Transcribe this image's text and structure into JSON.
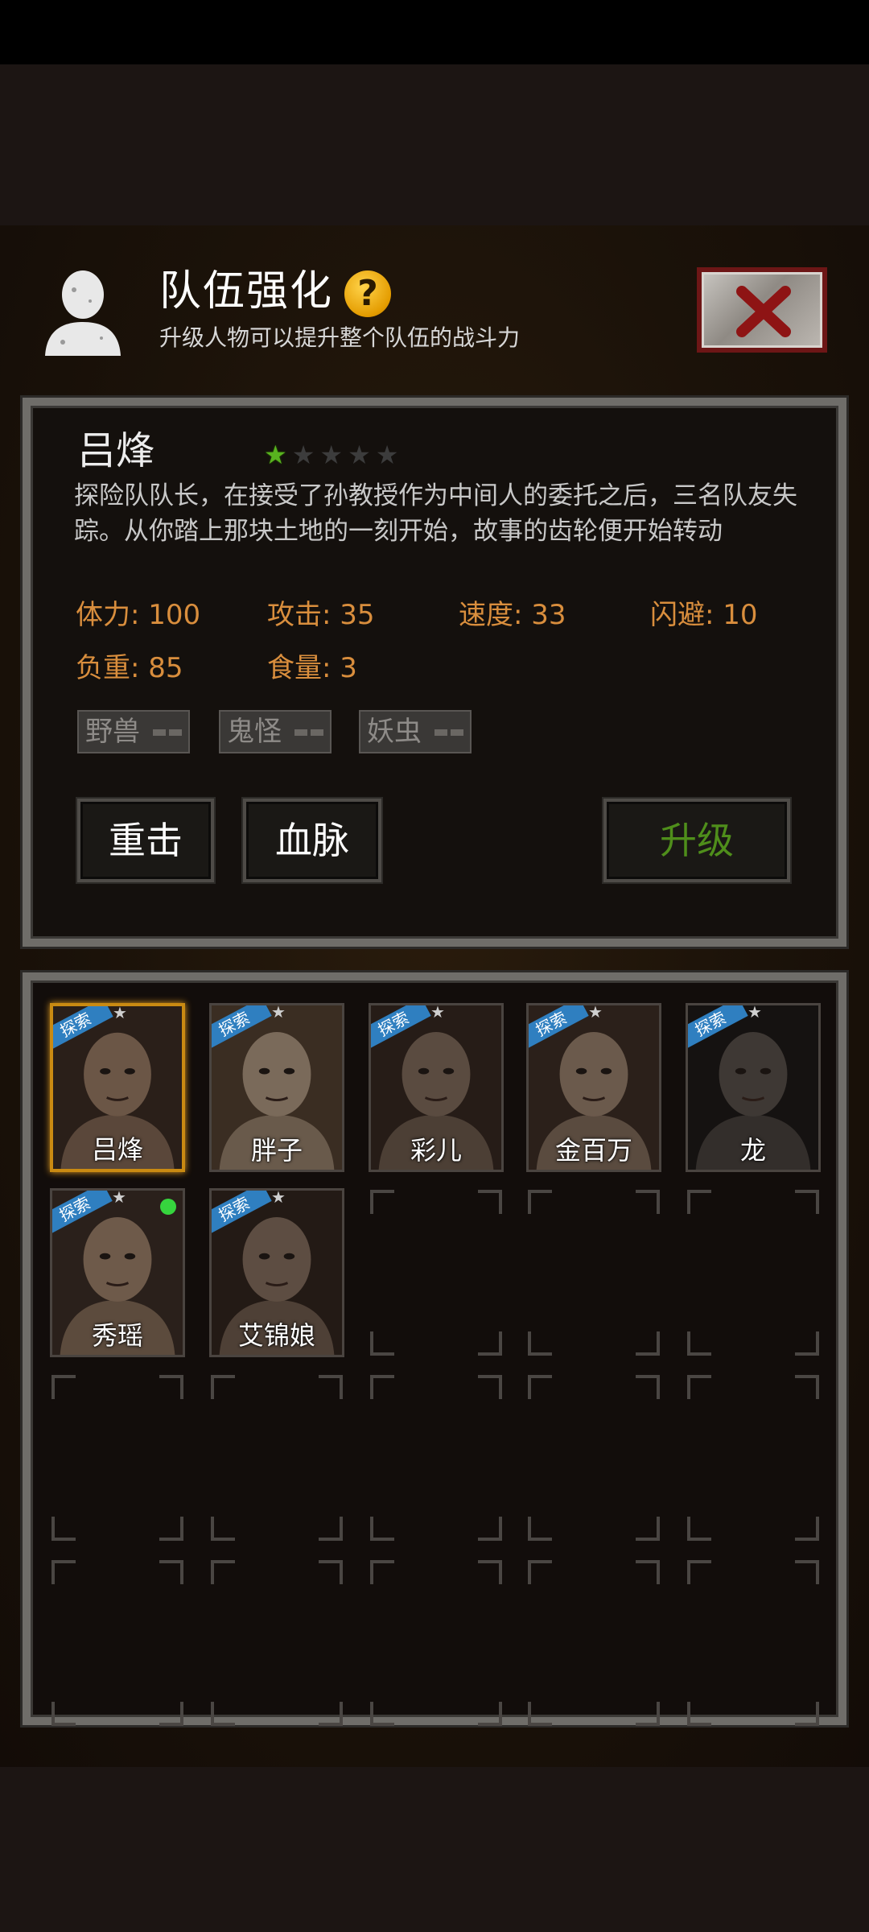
{
  "header": {
    "title": "队伍强化",
    "help_icon": "question-icon",
    "subtitle": "升级人物可以提升整个队伍的战斗力",
    "close_icon": "close-icon"
  },
  "detail": {
    "name": "吕烽",
    "stars": {
      "filled": 1,
      "total": 5
    },
    "description": "探险队队长，在接受了孙教授作为中间人的委托之后，三名队友失踪。从你踏上那块土地的一刻开始，故事的齿轮便开始转动",
    "stats": {
      "hp": "体力: 100",
      "attack": "攻击: 35",
      "speed": "速度: 33",
      "dodge": "闪避: 10",
      "load": "负重: 85",
      "food": "食量: 3"
    },
    "tags": [
      "野兽",
      "鬼怪",
      "妖虫"
    ],
    "buttons": {
      "skill1": "重击",
      "skill2": "血脉",
      "upgrade": "升级"
    }
  },
  "roster": {
    "badge_text": "探索",
    "members": [
      {
        "name": "吕烽",
        "selected": true,
        "badge": true,
        "new": false
      },
      {
        "name": "胖子",
        "selected": false,
        "badge": true,
        "new": false
      },
      {
        "name": "彩儿",
        "selected": false,
        "badge": true,
        "new": false
      },
      {
        "name": "金百万",
        "selected": false,
        "badge": true,
        "new": false
      },
      {
        "name": "龙",
        "selected": false,
        "badge": true,
        "new": false
      },
      {
        "name": "秀瑶",
        "selected": false,
        "badge": true,
        "new": true
      },
      {
        "name": "艾锦娘",
        "selected": false,
        "badge": true,
        "new": false
      }
    ]
  },
  "colors": {
    "stat_orange": "#d98e3d",
    "star_green": "#58b21f",
    "upgrade_green": "#4f8e1b",
    "badge_blue": "#2f7fc0",
    "selected_gold": "#c98a12"
  }
}
